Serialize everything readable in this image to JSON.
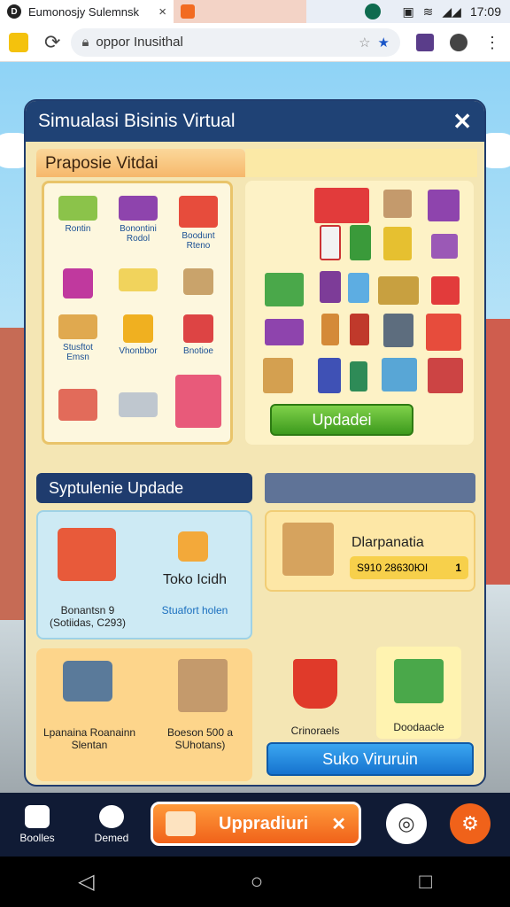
{
  "browser": {
    "tab_title": "Eumonosjy Sulemnsk",
    "tab_close": "×",
    "time": "17:09",
    "url": "oppor Inusithal"
  },
  "game": {
    "panel_title": "Simualasi Bisinis Virtual",
    "close": "✕",
    "section1_title": "Praposie Vitdai",
    "grid_labels": [
      "Rontin",
      "Bonontini Rodol",
      "Boodunt Rteno",
      "Stusftot Emsn",
      "Vhonbbor",
      "Bnotioe"
    ],
    "update_button": "Updadei",
    "section2_title": "Syptulenie Updade",
    "card1": {
      "label1": "Bonantsn 9 (Sotiidas, C293)",
      "title": "Toko Icidh",
      "link": "Stuafort holen"
    },
    "card2": {
      "title": "Dlarpanatia",
      "value": "S910 28630ЮI",
      "badge": "1"
    },
    "card3": {
      "item1": "Lpanaina Roanainn Slentan",
      "item2": "Boeson 500 a SUhotans)"
    },
    "fruit_label": "Crinoraels",
    "basket_label": "Doodaacle",
    "suko_button": "Suko Viruruin"
  },
  "bottom_nav": {
    "item1": "Boolles",
    "item2": "Demed",
    "upgrade": "Uppradiuri",
    "upgrade_close": "✕"
  },
  "colors": {
    "accent": "#1f4275",
    "upgrade": "#f0621a",
    "update": "#4aa82a"
  }
}
